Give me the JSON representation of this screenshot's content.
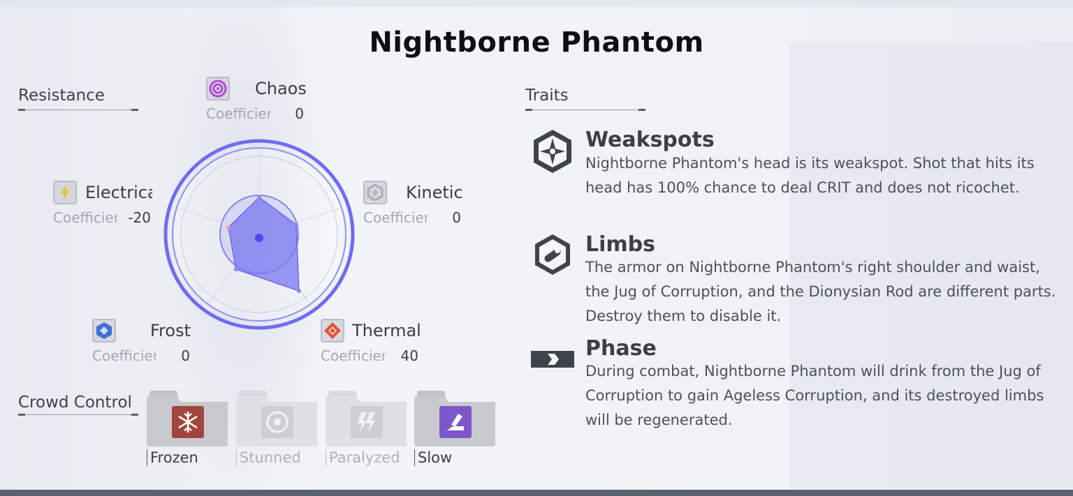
{
  "title": "Nightborne Phantom",
  "resistance": {
    "label": "Resistance",
    "items": [
      {
        "name": "Chaos",
        "coef_label": "Coefficient",
        "value": "0",
        "icon": "chaos-icon",
        "color": "#b04ad6"
      },
      {
        "name": "Kinetic",
        "coef_label": "Coefficient",
        "value": "0",
        "icon": "kinetic-icon",
        "color": "#9aa0aa"
      },
      {
        "name": "Thermal",
        "coef_label": "Coefficient",
        "value": "40",
        "icon": "thermal-icon",
        "color": "#e0533d"
      },
      {
        "name": "Frost",
        "coef_label": "Coefficient",
        "value": "0",
        "icon": "frost-icon",
        "color": "#3d6fd6"
      },
      {
        "name": "Electrical",
        "coef_label": "Coefficient",
        "value": "-20",
        "icon": "electrical-icon",
        "color": "#e8c62a"
      }
    ]
  },
  "crowd_control": {
    "label": "Crowd Control",
    "items": [
      {
        "name": "Frozen",
        "active": true,
        "icon": "frozen-icon",
        "color": "#a2453e"
      },
      {
        "name": "Stunned",
        "active": false,
        "icon": "stunned-icon",
        "color": "#b9bbc2"
      },
      {
        "name": "Paralyzed",
        "active": false,
        "icon": "paralyzed-icon",
        "color": "#b9bbc2"
      },
      {
        "name": "Slow",
        "active": true,
        "icon": "slow-icon",
        "color": "#7b57c7"
      }
    ]
  },
  "traits": {
    "label": "Traits",
    "items": [
      {
        "name": "Weakspots",
        "icon": "weakspot-icon",
        "description": "Nightborne Phantom's head is its weakspot. Shot that hits its head has 100% chance to deal CRIT and does not ricochet."
      },
      {
        "name": "Limbs",
        "icon": "limbs-icon",
        "description": "The armor on Nightborne Phantom's right shoulder and waist, the Jug of Corruption, and the Dionysian Rod are different parts. Destroy them to disable it."
      },
      {
        "name": "Phase",
        "icon": "phase-icon",
        "description": "During combat, Nightborne Phantom will drink from the Jug of Corruption to gain Ageless Corruption, and its destroyed limbs will be regenerated."
      }
    ]
  },
  "colors": {
    "accent": "#6f6cf0",
    "radar_fill": "#7a78f2"
  }
}
